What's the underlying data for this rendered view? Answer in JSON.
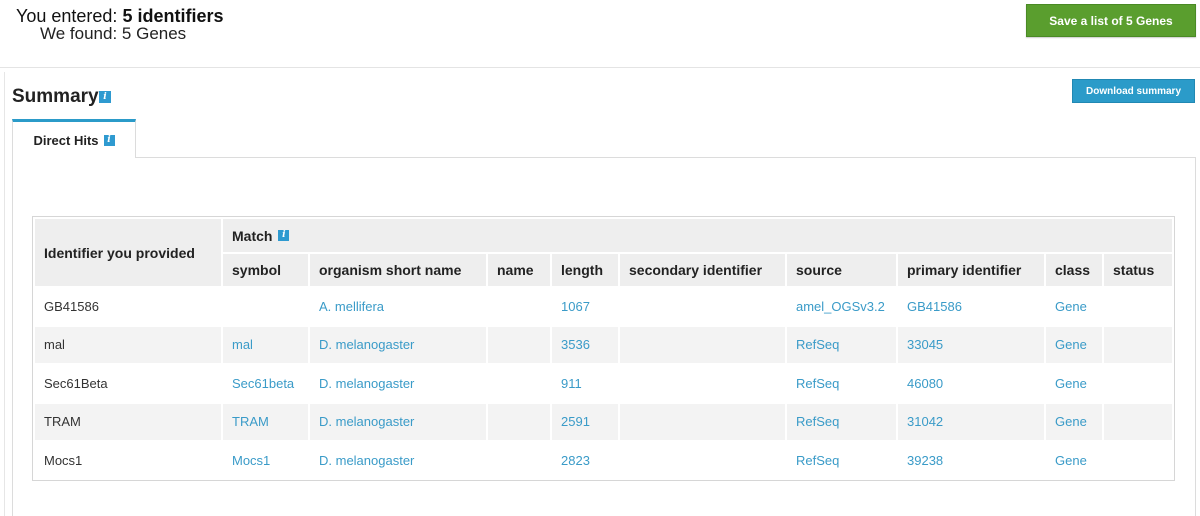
{
  "header": {
    "entered_label": "You entered:",
    "entered_value": "5 identifiers",
    "found_label": "We found:",
    "found_value": "5 Genes",
    "save_button": "Save a list of 5 Genes"
  },
  "summary": {
    "title": "Summary",
    "info_glyph": "i",
    "download_button": "Download summary"
  },
  "tabs": [
    {
      "label": "Direct Hits",
      "active": true
    }
  ],
  "table": {
    "provided_header": "Identifier you provided",
    "match_header": "Match",
    "columns": [
      "symbol",
      "organism short name",
      "name",
      "length",
      "secondary identifier",
      "source",
      "primary identifier",
      "class",
      "status"
    ],
    "rows": [
      {
        "provided": "GB41586",
        "symbol": "",
        "organism": "A. mellifera",
        "name": "",
        "length": "1067",
        "secondary": "",
        "source": "amel_OGSv3.2",
        "primary": "GB41586",
        "class": "Gene",
        "status": ""
      },
      {
        "provided": "mal",
        "symbol": "mal",
        "organism": "D. melanogaster",
        "name": "",
        "length": "3536",
        "secondary": "",
        "source": "RefSeq",
        "primary": "33045",
        "class": "Gene",
        "status": ""
      },
      {
        "provided": "Sec61Beta",
        "symbol": "Sec61beta",
        "organism": "D. melanogaster",
        "name": "",
        "length": "911",
        "secondary": "",
        "source": "RefSeq",
        "primary": "46080",
        "class": "Gene",
        "status": ""
      },
      {
        "provided": "TRAM",
        "symbol": "TRAM",
        "organism": "D. melanogaster",
        "name": "",
        "length": "2591",
        "secondary": "",
        "source": "RefSeq",
        "primary": "31042",
        "class": "Gene",
        "status": ""
      },
      {
        "provided": "Mocs1",
        "symbol": "Mocs1",
        "organism": "D. melanogaster",
        "name": "",
        "length": "2823",
        "secondary": "",
        "source": "RefSeq",
        "primary": "39238",
        "class": "Gene",
        "status": ""
      }
    ]
  },
  "colors": {
    "save_button": "#5a9e2e",
    "accent": "#2b9bc9",
    "link": "#3a9bc8",
    "info_icon": "#2e9ad0"
  },
  "icons": {
    "info": "info-icon"
  }
}
